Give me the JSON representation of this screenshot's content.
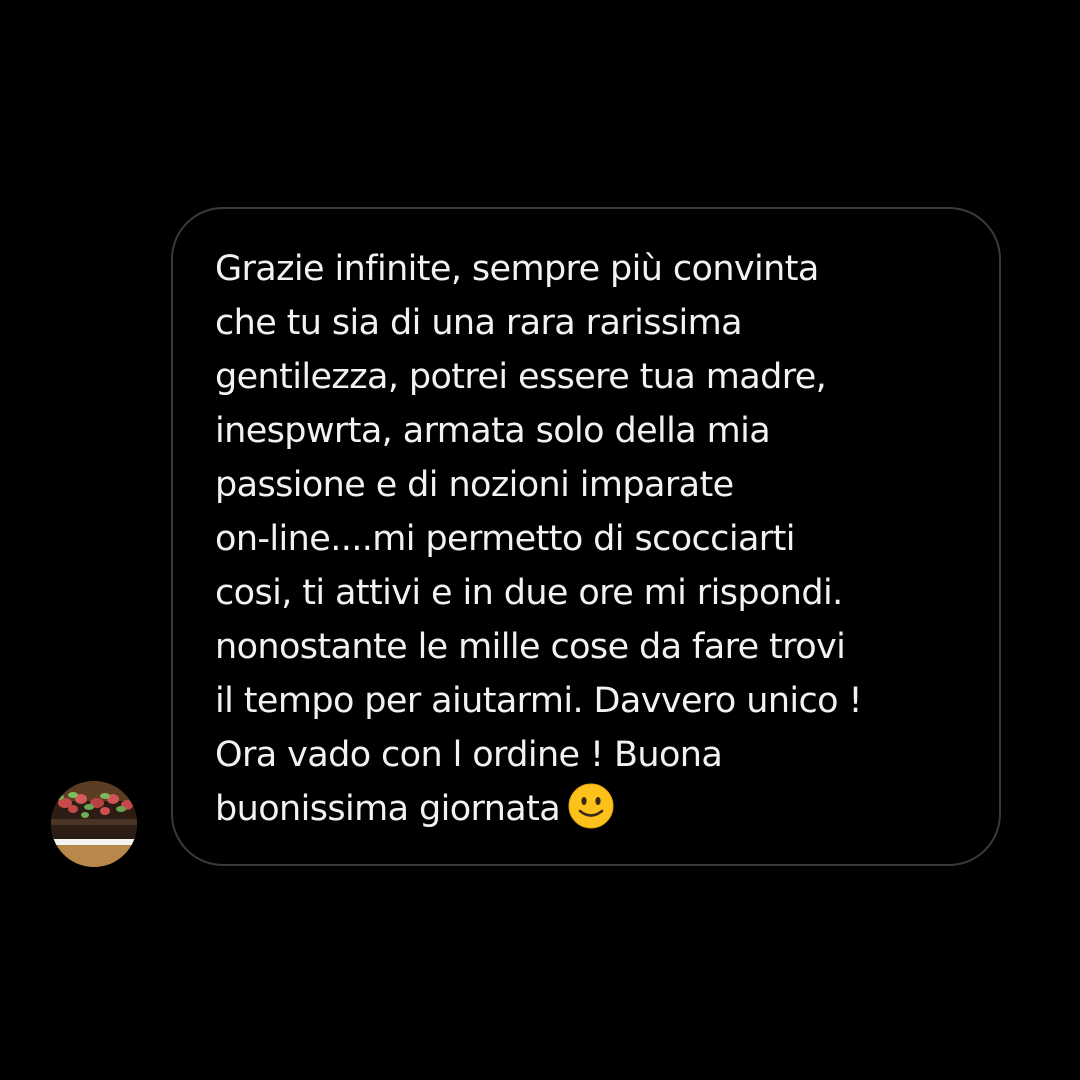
{
  "conversation": {
    "message": {
      "text": "Grazie infinite,  sempre più convinta\nche tu sia di una rara rarissima\ngentilezza,  potrei essere tua madre,\ninespwrta, armata solo della mia\npassione e di nozioni imparate\non-line....mi permetto di scocciarti\ncosi, ti attivi e in due ore mi rispondi.\nnonostante le mille cose da fare trovi\nil tempo per aiutarmi. Davvero unico !\nOra vado con l ordine ! Buona\nbuonissima giornata",
      "trailing_emoji": "slightly-smiling-face"
    },
    "sender_avatar": "cake-photo"
  },
  "colors": {
    "background": "#000000",
    "bubble_border": "#3a3a3a",
    "text": "#f2f2f2",
    "emoji_face": "#fcc21b"
  }
}
